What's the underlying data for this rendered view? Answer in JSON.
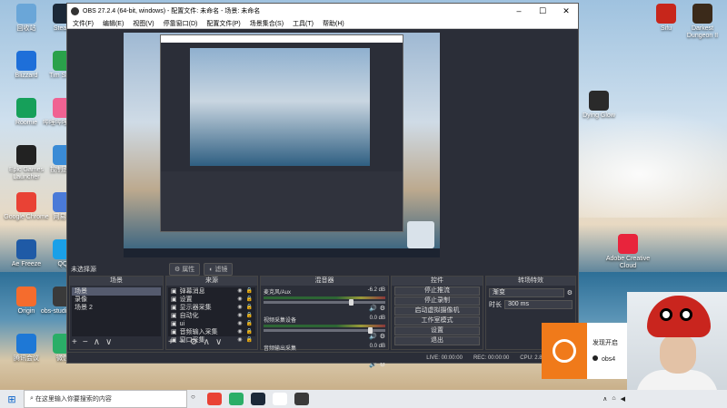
{
  "desktop": {
    "icons_left": [
      {
        "label": "回收站",
        "color": "#6aa6d8"
      },
      {
        "label": "Steam",
        "color": "#1b2838"
      },
      {
        "label": "Blizzard",
        "color": "#1e6fd9"
      },
      {
        "label": "Tim Shan",
        "color": "#2aa14a"
      },
      {
        "label": "Roomie",
        "color": "#16a05a"
      },
      {
        "label": "哔哩哔哩 直播",
        "color": "#f06292"
      },
      {
        "label": "Epic Games Launcher",
        "color": "#222222"
      },
      {
        "label": "控制面板",
        "color": "#3a8bd6"
      },
      {
        "label": "Google Chrome",
        "color": "#e94235"
      },
      {
        "label": "网易云",
        "color": "#4a7ad8"
      },
      {
        "label": "Ae Freeze",
        "color": "#1f5aa6"
      },
      {
        "label": "QQ",
        "color": "#1aa0e8"
      },
      {
        "label": "Origin",
        "color": "#f56c2d"
      },
      {
        "label": "obs-studio 直播",
        "color": "#3a3a3a"
      },
      {
        "label": "腾讯会议",
        "color": "#1e78d6"
      },
      {
        "label": "微信",
        "color": "#2aae67"
      }
    ],
    "icons_right": [
      {
        "label": "Sifu",
        "color": "#c7261b"
      },
      {
        "label": "Darkest Dungeon II",
        "color": "#3b2a1a"
      },
      {
        "label": "Dying Glow",
        "color": "#2a2a2a"
      },
      {
        "label": "Adobe Creative Cloud",
        "color": "#e8243c"
      }
    ]
  },
  "obs": {
    "title": "OBS 27.2.4 (64-bit, windows) - 配置文件: 未命名 - 场景: 未命名",
    "menu": [
      "文件(F)",
      "编辑(E)",
      "视图(V)",
      "停靠窗口(D)",
      "配置文件(P)",
      "场景集合(S)",
      "工具(T)",
      "帮助(H)"
    ],
    "no_source_label": "未选择源",
    "properties_btn": "属性",
    "filters_btn": "滤镜",
    "scenes": {
      "header": "场景",
      "items": [
        "场景",
        "录像",
        "场景 2"
      ]
    },
    "sources": {
      "header": "来源",
      "items": [
        "弹幕消息",
        "设置",
        "显示器采集",
        "自动化",
        "ui",
        "音频输入采集",
        "窗口采集"
      ]
    },
    "mixer": {
      "header": "混音器",
      "channels": [
        {
          "name": "麦克风/Aux",
          "db": "-6.2 dB"
        },
        {
          "name": "视频采集设备",
          "db": "0.0 dB"
        },
        {
          "name": "音频输出采集",
          "db": "0.0 dB"
        }
      ]
    },
    "controls": {
      "header": "控件",
      "buttons": [
        "停止推流",
        "停止录制",
        "启动虚拟摄像机",
        "工作室模式",
        "设置",
        "退出"
      ]
    },
    "transitions": {
      "header": "转场特效",
      "selected": "渐变",
      "duration_label": "时长",
      "duration_value": "300 ms"
    },
    "status": {
      "live": "LIVE: 00:00:00",
      "rec": "REC: 00:00:00",
      "cpu": "CPU: 2.8%, 60.00 fps"
    }
  },
  "notification": {
    "title": "发现开启",
    "body": "obs4"
  },
  "taskbar": {
    "search_placeholder": "在这里输入你要搜索的内容",
    "apps": [
      {
        "name": "chrome",
        "color": "#e94235"
      },
      {
        "name": "wechat",
        "color": "#2aae67"
      },
      {
        "name": "steam",
        "color": "#1b2838"
      },
      {
        "name": "app",
        "color": "#ffffff"
      },
      {
        "name": "obs",
        "color": "#3a3a3a"
      }
    ]
  }
}
